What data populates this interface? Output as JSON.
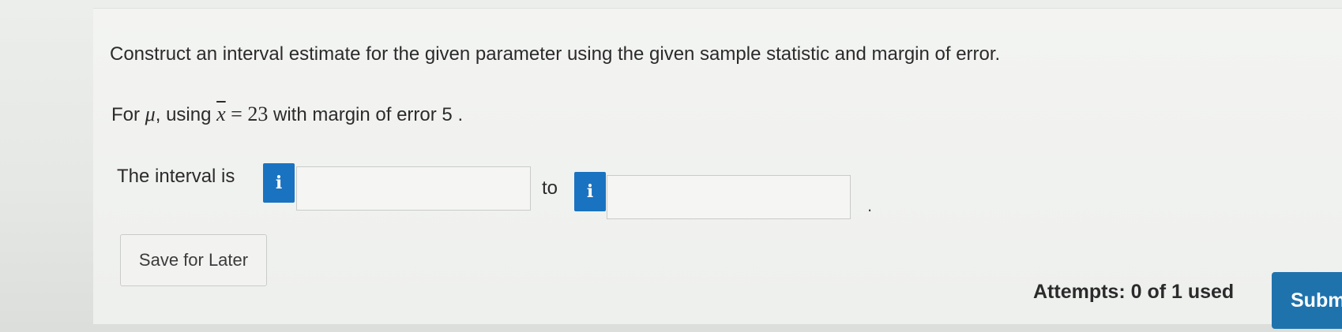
{
  "question": {
    "prompt": "Construct an interval estimate for the given parameter using the given sample statistic and margin of error.",
    "given_prefix": "For ",
    "param_symbol": "μ",
    "given_mid": ", using ",
    "stat_symbol": "x",
    "equals": " = ",
    "stat_value": "23",
    "given_suffix": " with margin of error ",
    "margin_value": "5",
    "given_end": " ."
  },
  "answer": {
    "interval_label": "The interval is",
    "info_glyph": "i",
    "lower_value": "",
    "to_label": "to",
    "upper_value": "",
    "period": "."
  },
  "actions": {
    "save_label": "Save for Later",
    "attempts_text": "Attempts: 0 of 1 used",
    "submit_label": "Subm"
  },
  "colors": {
    "info_button": "#1a73c0",
    "submit_button": "#1f73ad"
  }
}
